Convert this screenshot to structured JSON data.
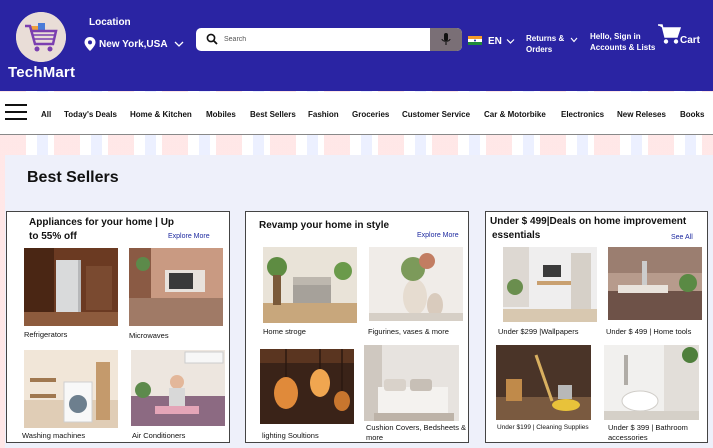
{
  "header": {
    "brand": "TechMart",
    "location_label": "Location",
    "location_value": "New York,USA",
    "search_placeholder": "Search",
    "language": "EN",
    "returns_line1": "Returns &",
    "returns_line2": "Orders",
    "account_line1": "Hello, Sign in",
    "account_line2": "Accounts & Lists",
    "cart_label": "Cart",
    "bg_color": "#2a24a3"
  },
  "nav": {
    "items": [
      "All",
      "Today's Deals",
      "Home & Kitchen",
      "Mobiles",
      "Best Sellers",
      "Fashion",
      "Groceries",
      "Customer Service",
      "Car & Motorbike",
      "Electronics",
      "New Releses",
      "Books"
    ]
  },
  "main": {
    "title": "Best Sellers",
    "cards": [
      {
        "title_line1": "Appliances for your home | Up",
        "title_line2": "to 55% off",
        "link": "Explore More",
        "tiles": [
          "Refrigerators",
          "Microwaves",
          "Washing machines",
          "Air Conditioners"
        ]
      },
      {
        "title_line1": "Revamp your home in style",
        "link": "Explore More",
        "tiles": [
          "Home stroge",
          "Figurines, vases & more",
          "lighting Soultions",
          "Cushion Covers, Bedsheets & more"
        ]
      },
      {
        "title_line1": "Under $ 499|Deals on home improvement",
        "title_line2": "essentials",
        "link": "See All",
        "tiles": [
          "Under $299 |Wallpapers",
          "Under $ 499 | Home tools",
          "Under $199 | Cleaning Supplies",
          "Under $ 399 | Bathroom accessories"
        ]
      }
    ]
  }
}
